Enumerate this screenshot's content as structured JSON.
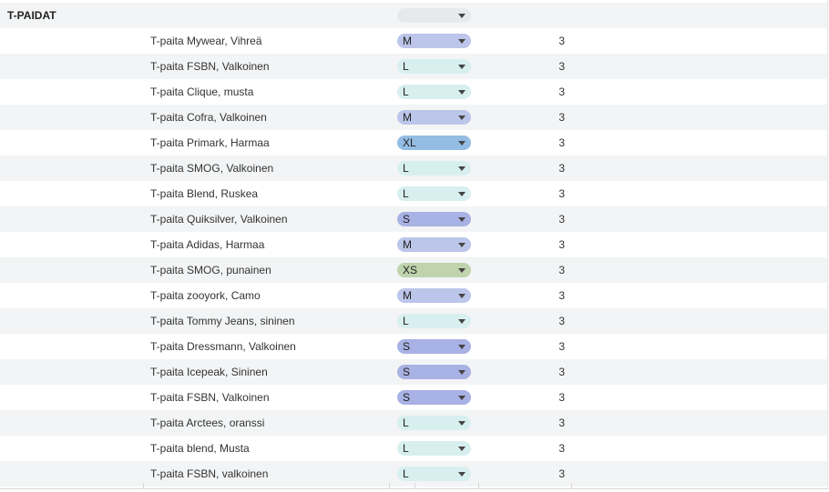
{
  "category": {
    "title": "T-PAIDAT",
    "size_empty": ""
  },
  "size_colors": {
    "XS": "#bfd4ad",
    "S": "#a9b2e4",
    "M": "#bcc6ea",
    "L": "#d8eff0",
    "XL": "#94bde3",
    "empty": "#e8e9ec"
  },
  "icons": {
    "dropdown": "chevron-down-icon"
  },
  "rows": [
    {
      "name": "T-paita Mywear, Vihreä",
      "size": "M",
      "qty": "3"
    },
    {
      "name": "T-paita FSBN, Valkoinen",
      "size": "L",
      "qty": "3"
    },
    {
      "name": "T-paita Clique, musta",
      "size": "L",
      "qty": "3"
    },
    {
      "name": "T-paita Cofra, Valkoinen",
      "size": "M",
      "qty": "3"
    },
    {
      "name": "T-paita Primark, Harmaa",
      "size": "XL",
      "qty": "3"
    },
    {
      "name": "T-paita SMOG, Valkoinen",
      "size": "L",
      "qty": "3"
    },
    {
      "name": "T-paita Blend, Ruskea",
      "size": "L",
      "qty": "3"
    },
    {
      "name": "T-paita Quiksilver, Valkoinen",
      "size": "S",
      "qty": "3"
    },
    {
      "name": "T-paita Adidas, Harmaa",
      "size": "M",
      "qty": "3"
    },
    {
      "name": "T-paita SMOG, punainen",
      "size": "XS",
      "qty": "3"
    },
    {
      "name": "T-paita zooyork, Camo",
      "size": "M",
      "qty": "3"
    },
    {
      "name": "T-paita Tommy Jeans, sininen",
      "size": "L",
      "qty": "3"
    },
    {
      "name": "T-paita Dressmann, Valkoinen",
      "size": "S",
      "qty": "3"
    },
    {
      "name": "T-paita Icepeak, Sininen",
      "size": "S",
      "qty": "3"
    },
    {
      "name": "T-paita FSBN, Valkoinen",
      "size": "S",
      "qty": "3"
    },
    {
      "name": "T-paita Arctees, oranssi",
      "size": "L",
      "qty": "3"
    },
    {
      "name": "T-paita blend, Musta",
      "size": "L",
      "qty": "3"
    },
    {
      "name": "T-paita FSBN, valkoinen",
      "size": "L",
      "qty": "3"
    }
  ]
}
